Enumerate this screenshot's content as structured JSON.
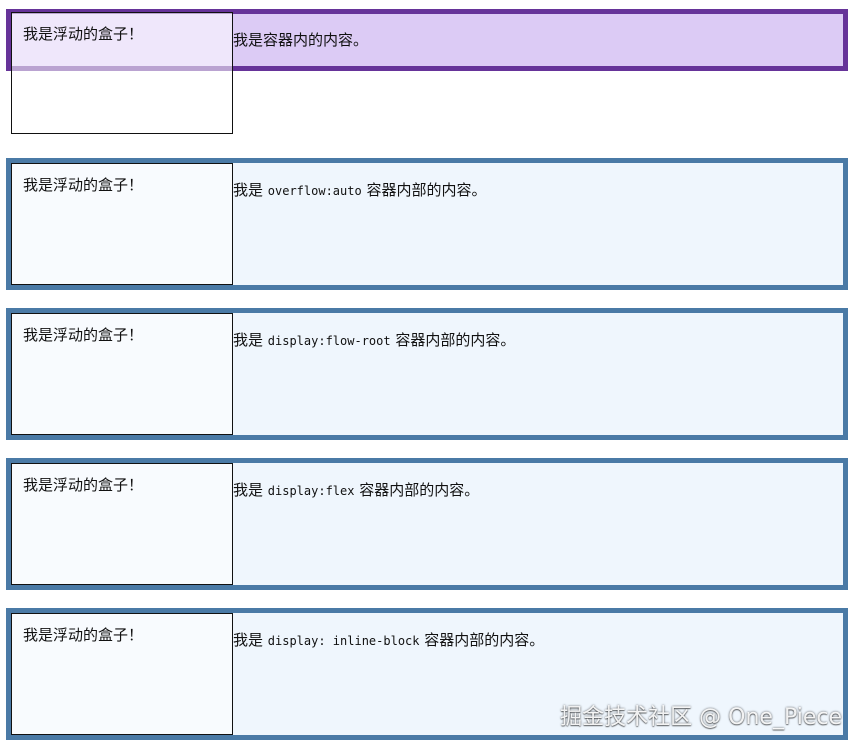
{
  "examples": [
    {
      "float_label": "我是浮动的盒子！",
      "content_prefix": "我是容器内的内容。",
      "code_text": "",
      "content_suffix": ""
    },
    {
      "float_label": "我是浮动的盒子！",
      "content_prefix": "我是 ",
      "code_text": "overflow:auto",
      "content_suffix": " 容器内部的内容。"
    },
    {
      "float_label": "我是浮动的盒子！",
      "content_prefix": "我是 ",
      "code_text": "display:flow-root",
      "content_suffix": " 容器内部的内容。"
    },
    {
      "float_label": "我是浮动的盒子！",
      "content_prefix": "我是 ",
      "code_text": "display:flex",
      "content_suffix": " 容器内部的内容。"
    },
    {
      "float_label": "我是浮动的盒子！",
      "content_prefix": "我是 ",
      "code_text": "display: inline-block",
      "content_suffix": " 容器内部的内容。"
    }
  ],
  "watermark": "掘金技术社区 @ One_Piece",
  "colors": {
    "purple_border": "#663399",
    "purple_background": "#dccbf5",
    "blue_border": "#4a7aa6",
    "blue_background": "#eff6fd",
    "float_border": "#111111"
  }
}
